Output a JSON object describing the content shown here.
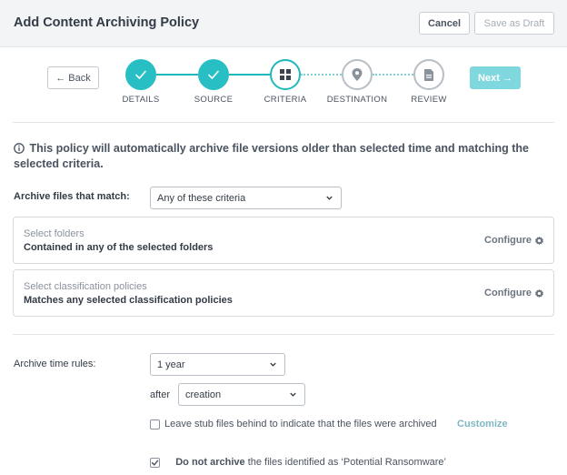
{
  "header": {
    "title": "Add Content Archiving Policy",
    "cancel_label": "Cancel",
    "save_draft_label": "Save as Draft"
  },
  "wizard": {
    "back_label": "← Back",
    "next_label": "Next →",
    "steps": [
      {
        "label": "DETAILS",
        "state": "done",
        "icon": "check-icon"
      },
      {
        "label": "SOURCE",
        "state": "done",
        "icon": "check-icon"
      },
      {
        "label": "CRITERIA",
        "state": "active",
        "icon": "grid-icon"
      },
      {
        "label": "DESTINATION",
        "state": "todo",
        "icon": "map-pin-icon"
      },
      {
        "label": "REVIEW",
        "state": "todo",
        "icon": "document-icon"
      }
    ]
  },
  "info_text": "This policy will automatically archive file versions older than selected time and matching the selected criteria.",
  "criteria": {
    "match_label": "Archive files that match:",
    "match_value": "Any of these criteria",
    "folders": {
      "title": "Select folders",
      "description": "Contained in any of the selected folders",
      "configure_label": "Configure"
    },
    "classification": {
      "title": "Select classification policies",
      "description": "Matches any selected classification policies",
      "configure_label": "Configure"
    }
  },
  "time_rules": {
    "label": "Archive time rules:",
    "period_value": "1 year",
    "after_label": "after",
    "after_value": "creation",
    "stub_label": "Leave stub files behind to indicate that the files were archived",
    "stub_checked": false,
    "customize_label": "Customize",
    "ransomware_bold": "Do not archive",
    "ransomware_rest": " the files identified as ‘Potential Ransomware’",
    "ransomware_checked": true
  },
  "colors": {
    "accent": "#20b8bd",
    "accent_light": "#7fd8dd",
    "header_bg": "#f3f4f6"
  }
}
